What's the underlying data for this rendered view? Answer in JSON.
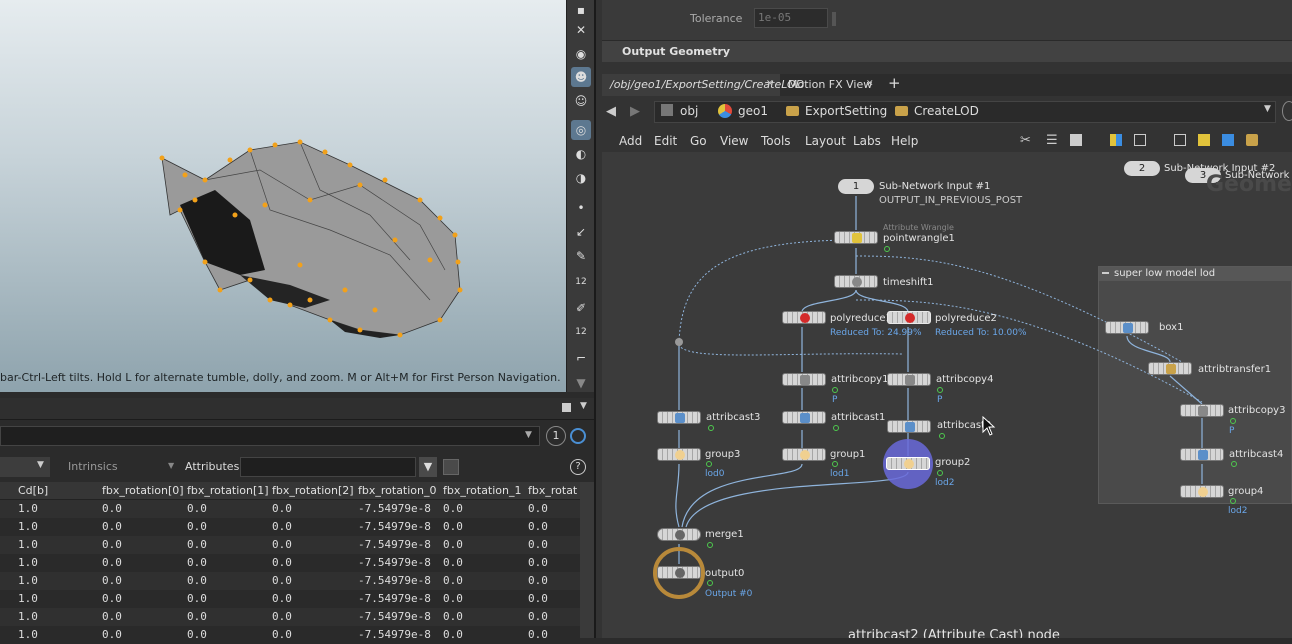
{
  "viewport": {
    "hint": "bar-Ctrl-Left tilts. Hold L for alternate tumble, dolly, and zoom. M or Alt+M for First Person Navigation.",
    "tool_icons": [
      "select-icon",
      "pose-icon",
      "handle-icon",
      "bone-icon",
      "view-icon",
      "camera-icon",
      "wire-icon",
      "hide-icon",
      "point-icon",
      "edge-icon",
      "pin-icon",
      "number-icon",
      "snap-icon",
      "num2-icon",
      "angle-icon",
      "arrow-down-icon"
    ],
    "side_texts": [
      "12",
      "12"
    ]
  },
  "params": {
    "tolerance_label": "Tolerance",
    "tolerance_value": "1e-05",
    "output_geometry": "Output Geometry"
  },
  "tabs": {
    "path_tab": "/obj/geo1/ExportSetting/CreateLOD",
    "motion_tab": "Motion FX View",
    "plus": "+"
  },
  "breadcrumb": {
    "obj": "obj",
    "geo1": "geo1",
    "export": "ExportSetting",
    "create": "CreateLOD"
  },
  "menu": [
    "Add",
    "Edit",
    "Go",
    "View",
    "Tools",
    "Layout",
    "Labs",
    "Help"
  ],
  "sheet": {
    "group_placeholder": "",
    "intrinsics": "Intrinsics",
    "attributes_label": "Attributes:",
    "badge": "1",
    "help": "?",
    "columns": [
      "Cd[b]",
      "fbx_rotation[0]",
      "fbx_rotation[1]",
      "fbx_rotation[2]",
      "fbx_rotation_0",
      "fbx_rotation_1",
      "fbx_rotati"
    ],
    "rows": [
      [
        "1.0",
        "0.0",
        "0.0",
        "0.0",
        "-7.54979e-8",
        "0.0",
        "0.0"
      ],
      [
        "1.0",
        "0.0",
        "0.0",
        "0.0",
        "-7.54979e-8",
        "0.0",
        "0.0"
      ],
      [
        "1.0",
        "0.0",
        "0.0",
        "0.0",
        "-7.54979e-8",
        "0.0",
        "0.0"
      ],
      [
        "1.0",
        "0.0",
        "0.0",
        "0.0",
        "-7.54979e-8",
        "0.0",
        "0.0"
      ],
      [
        "1.0",
        "0.0",
        "0.0",
        "0.0",
        "-7.54979e-8",
        "0.0",
        "0.0"
      ],
      [
        "1.0",
        "0.0",
        "0.0",
        "0.0",
        "-7.54979e-8",
        "0.0",
        "0.0"
      ],
      [
        "1.0",
        "0.0",
        "0.0",
        "0.0",
        "-7.54979e-8",
        "0.0",
        "0.0"
      ],
      [
        "1.0",
        "0.0",
        "0.0",
        "0.0",
        "-7.54979e-8",
        "0.0",
        "0.0"
      ]
    ]
  },
  "network": {
    "subnet_input1_num": "1",
    "subnet_input1": "Sub-Network Input #1",
    "subnet_input1_sub": "OUTPUT_IN_PREVIOUS_POST",
    "subnet_input2_num": "2",
    "subnet_input2": "Sub-Network Input #2",
    "subnet_input3_num": "3",
    "subnet_input3": "Sub-Network In",
    "geo_watermark": "Geome",
    "pointwrangle_type": "Attribute Wrangle",
    "pointwrangle": "pointwrangle1",
    "timeshift": "timeshift1",
    "polyreduce1": "polyreduce1",
    "polyreduce1_sub": "Reduced To: 24.99%",
    "polyreduce2": "polyreduce2",
    "polyreduce2_sub": "Reduced To: 10.00%",
    "attribcopy1": "attribcopy1",
    "attribcopy1_sub": "P",
    "attribcopy4": "attribcopy4",
    "attribcopy4_sub": "P",
    "attribcast3": "attribcast3",
    "attribcast1": "attribcast1",
    "attribcast2": "attribcast2",
    "group3": "group3",
    "group3_sub": "lod0",
    "group1": "group1",
    "group1_sub": "lod1",
    "group2": "group2",
    "group2_sub": "lod2",
    "merge1": "merge1",
    "output0": "output0",
    "output0_sub": "Output #0",
    "netbox_title": "super low model lod",
    "box1": "box1",
    "attribtransfer1": "attribtransfer1",
    "attribcopy3": "attribcopy3",
    "attribcopy3_sub": "P",
    "attribcast4": "attribcast4",
    "group4": "group4",
    "group4_sub": "lod2",
    "status_text": "attribcast2 (Attribute Cast) node"
  },
  "colors": {
    "accent": "#5d7890",
    "wire": "#8fb4dc",
    "link_text": "#6aa6e8",
    "selected": "#6a6adb",
    "polyreduce": "#d42a2a",
    "output_ring": "#b8893a"
  }
}
